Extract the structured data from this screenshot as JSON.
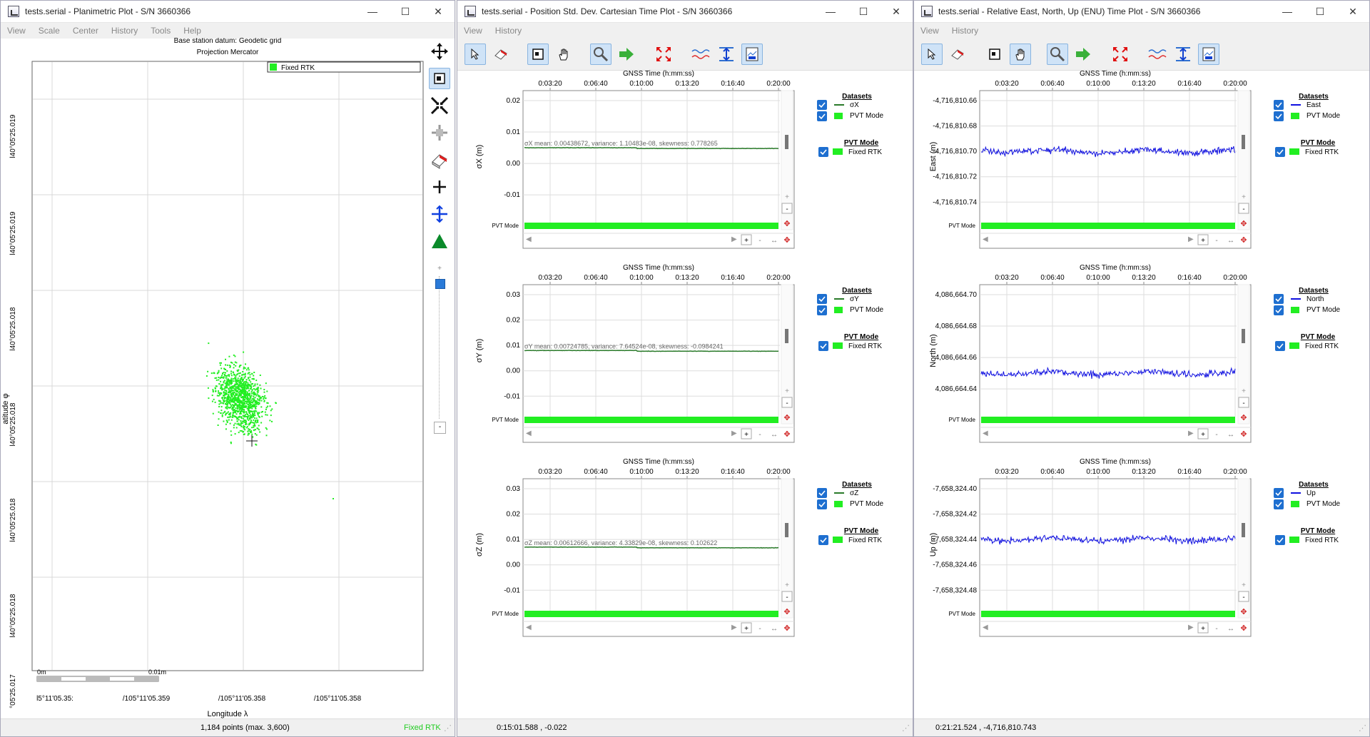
{
  "win1": {
    "title": "tests.serial - Planimetric Plot - S/N 3660366",
    "menu": [
      "View",
      "Scale",
      "Center",
      "History",
      "Tools",
      "Help"
    ],
    "header_line1": "Base station datum: Geodetic grid",
    "header_line2": "Projection Mercator",
    "legend_label": "Fixed RTK",
    "ylabel": "atitude φ",
    "xlabel": "Longitude λ",
    "y_ticks": [
      "l40°05'25.019",
      "l40°05'25.019",
      "l40°05'25.018",
      "l40°05'25.018",
      "l40°05'25.018",
      "l40°05'25.018",
      "°05'25.017"
    ],
    "x_ticks": [
      "l5°11'05.35:",
      "/105°11'05.359",
      "/105°11'05.358",
      "/105°11'05.358"
    ],
    "scale_start": "0m",
    "scale_end": "0.01m",
    "status_points": "1,184 points (max. 3,600)",
    "status_mode": "Fixed RTK",
    "color_fix": "#22ee22"
  },
  "win2": {
    "title": "tests.serial - Position Std. Dev. Cartesian Time Plot - S/N 3660366",
    "menu": [
      "View",
      "History"
    ],
    "status": "0:15:01.588 , -0.022",
    "time_title": "GNSS Time (h:mm:ss)",
    "time_ticks": [
      "0:03:20",
      "0:06:40",
      "0:10:00",
      "0:13:20",
      "0:16:40",
      "0:20:00"
    ],
    "pvt_label": "PVT Mode",
    "legend_title": "Datasets",
    "pvt_legend_title": "PVT Mode",
    "pvt_legend_item": "Fixed RTK",
    "plots": [
      {
        "ylabel": "σX (m)",
        "series": "σX",
        "yticks": [
          "0.02",
          "0.01",
          "0.00",
          "-0.01"
        ],
        "stats": "σX mean: 0.00438672, variance: 1.10483e-08, skewness: 0.778265"
      },
      {
        "ylabel": "σY (m)",
        "series": "σY",
        "yticks": [
          "0.03",
          "0.02",
          "0.01",
          "0.00",
          "-0.01"
        ],
        "stats": "σY mean: 0.00724785, variance: 7.64524e-08, skewness: -0.0984241"
      },
      {
        "ylabel": "σZ (m)",
        "series": "σZ",
        "yticks": [
          "0.03",
          "0.02",
          "0.01",
          "0.00",
          "-0.01"
        ],
        "stats": "σZ mean: 0.00612666, variance: 4.33829e-08, skewness: 0.102622"
      }
    ]
  },
  "win3": {
    "title": "tests.serial - Relative East, North, Up (ENU) Time Plot - S/N 3660366",
    "menu": [
      "View",
      "History"
    ],
    "status": "0:21:21.524 , -4,716,810.743",
    "time_title": "GNSS Time (h:mm:ss)",
    "time_ticks": [
      "0:03:20",
      "0:06:40",
      "0:10:00",
      "0:13:20",
      "0:16:40",
      "0:20:00"
    ],
    "pvt_label": "PVT Mode",
    "legend_title": "Datasets",
    "pvt_legend_title": "PVT Mode",
    "pvt_legend_item": "Fixed RTK",
    "plots": [
      {
        "ylabel": "East (m)",
        "series": "East",
        "yticks": [
          "-4,716,810.66",
          "-4,716,810.68",
          "-4,716,810.70",
          "-4,716,810.72",
          "-4,716,810.74"
        ]
      },
      {
        "ylabel": "North (m)",
        "series": "North",
        "yticks": [
          "4,086,664.70",
          "4,086,664.68",
          "4,086,664.66",
          "4,086,664.64"
        ]
      },
      {
        "ylabel": "Up (m)",
        "series": "Up",
        "yticks": [
          "-7,658,324.40",
          "-7,658,324.42",
          "-7,658,324.44",
          "-7,658,324.46",
          "-7,658,324.48"
        ]
      }
    ]
  },
  "colors": {
    "green": "#22ee22",
    "blue": "#1010e0",
    "check": "#1e6fd0",
    "axis": "#999999"
  }
}
